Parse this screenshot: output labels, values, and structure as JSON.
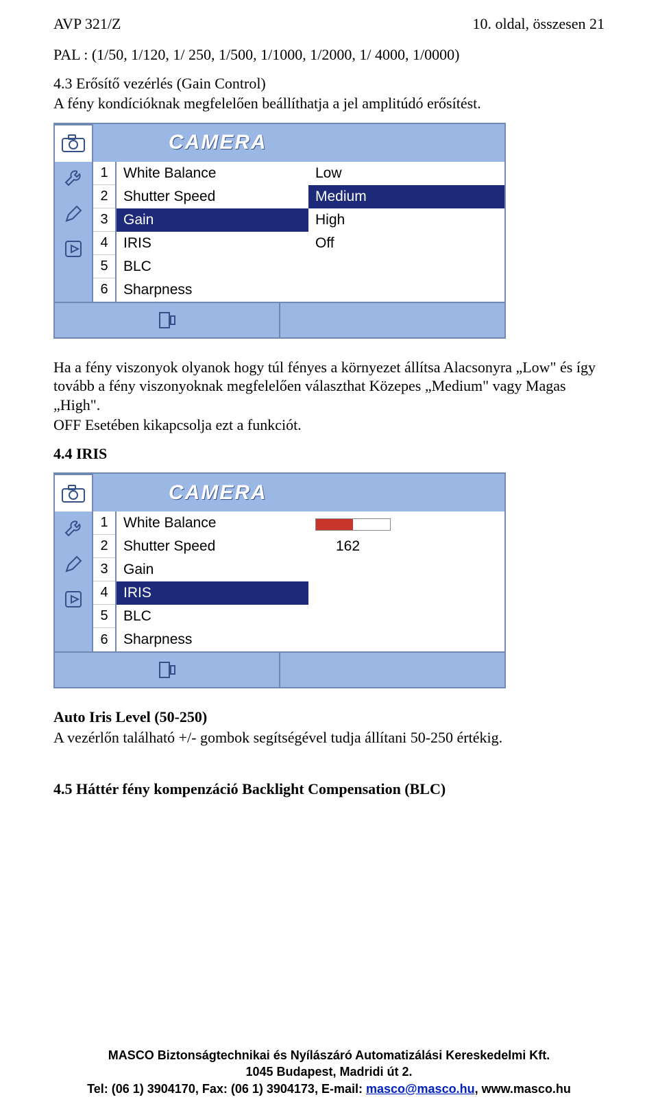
{
  "header": {
    "left": "AVP 321/Z",
    "right": "10. oldal, összesen 21"
  },
  "p1": "PAL : (1/50, 1/120, 1/ 250, 1/500, 1/1000, 1/2000, 1/ 4000, 1/0000)",
  "sec43_title": "4.3 Erősítő vezérlés (Gain Control)",
  "sec43_line": "A fény kondícióknak megfelelően beállíthatja a jel amplitúdó erősítést.",
  "menu_title": "CAMERA",
  "menu_items": [
    "White Balance",
    "Shutter Speed",
    "Gain",
    "IRIS",
    "BLC",
    "Sharpness"
  ],
  "menu_numbers": [
    "1",
    "2",
    "3",
    "4",
    "5",
    "6"
  ],
  "gain_options": [
    "Low",
    "Medium",
    "High",
    "Off"
  ],
  "gain_selected_item_index": 2,
  "gain_selected_option_index": 1,
  "p2a": "Ha a fény viszonyok olyanok hogy túl fényes a környezet állítsa Alacsonyra „Low\" és így tovább a fény viszonyoknak megfelelően választhat  Közepes „Medium\" vagy Magas „High\".",
  "p2b": "OFF Esetében kikapcsolja ezt a funkciót.",
  "sec44_title": "4.4 IRIS",
  "iris_value": "162",
  "iris_selected_item_index": 3,
  "p3_title": "Auto Iris Level (50-250)",
  "p3_line": "A vezérlőn található +/- gombok segítségével tudja állítani 50-250 értékig.",
  "sec45_title": "4.5 Háttér fény kompenzáció Backlight Compensation (BLC)",
  "footer": {
    "l1": "MASCO Biztonságtechnikai és Nyílászáró Automatizálási Kereskedelmi Kft.",
    "l2": "1045 Budapest, Madridi út 2.",
    "l3a": "Tel: (06 1) 3904170, Fax: (06 1) 3904173, E-mail: ",
    "email": "masco@masco.hu",
    "l3b": ", www.masco.hu"
  }
}
